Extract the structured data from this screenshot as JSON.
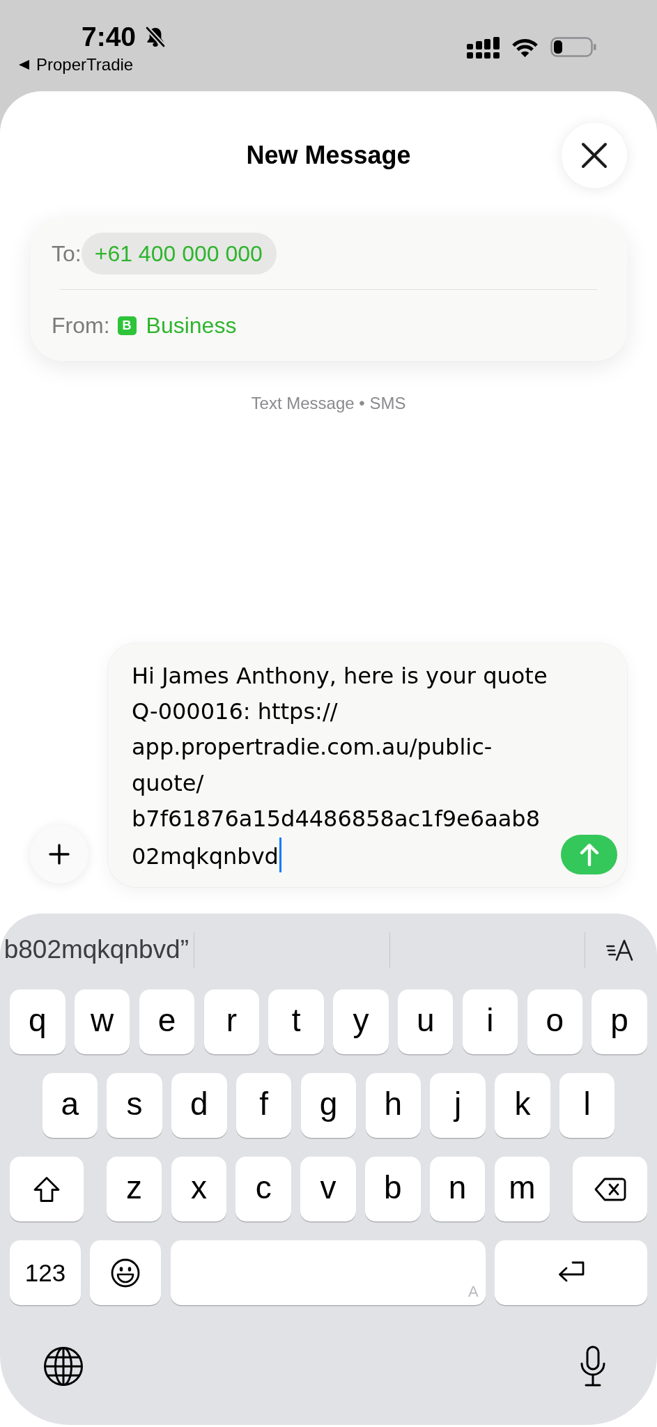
{
  "status_bar": {
    "time": "7:40",
    "silent": true,
    "back_label": "ProperTradie"
  },
  "header": {
    "title": "New Message"
  },
  "recipients": {
    "to_label": "To:",
    "to": "+61 400 000 000",
    "from_label": "From:",
    "from_badge": "B",
    "from": "Business"
  },
  "service": "Text Message • SMS",
  "compose": {
    "value": "Hi James Anthony, here is your quote Q-000016: https://app.propertradie.com.au/public-quote/b7f61876a15d4486858ac1f9e6aab802mqkqnbvd",
    "focused": true
  },
  "keyboard": {
    "suggestions": [
      "b802mqkqnbvd”"
    ],
    "rows": [
      [
        {
          "kind": "letter",
          "label": "q"
        },
        {
          "kind": "letter",
          "label": "w"
        },
        {
          "kind": "letter",
          "label": "e"
        },
        {
          "kind": "letter",
          "label": "r"
        },
        {
          "kind": "letter",
          "label": "t"
        },
        {
          "kind": "letter",
          "label": "y"
        },
        {
          "kind": "letter",
          "label": "u"
        },
        {
          "kind": "letter",
          "label": "i"
        },
        {
          "kind": "letter",
          "label": "o"
        },
        {
          "kind": "letter",
          "label": "p"
        }
      ],
      [
        {
          "kind": "letter",
          "label": "a"
        },
        {
          "kind": "letter",
          "label": "s"
        },
        {
          "kind": "letter",
          "label": "d"
        },
        {
          "kind": "letter",
          "label": "f"
        },
        {
          "kind": "letter",
          "label": "g"
        },
        {
          "kind": "letter",
          "label": "h"
        },
        {
          "kind": "letter",
          "label": "j"
        },
        {
          "kind": "letter",
          "label": "k"
        },
        {
          "kind": "letter",
          "label": "l"
        }
      ],
      [
        {
          "kind": "shift",
          "on": false
        },
        {
          "kind": "letter",
          "label": "z"
        },
        {
          "kind": "letter",
          "label": "x"
        },
        {
          "kind": "letter",
          "label": "c"
        },
        {
          "kind": "letter",
          "label": "v"
        },
        {
          "kind": "letter",
          "label": "b"
        },
        {
          "kind": "letter",
          "label": "n"
        },
        {
          "kind": "letter",
          "label": "m"
        },
        {
          "kind": "delete"
        }
      ],
      [
        {
          "kind": "numbers",
          "label": "123"
        },
        {
          "kind": "emoji"
        },
        {
          "kind": "space",
          "hint": "A"
        },
        {
          "kind": "return"
        }
      ]
    ],
    "bottom": [
      {
        "kind": "globe"
      },
      {
        "kind": "dictation"
      }
    ]
  }
}
